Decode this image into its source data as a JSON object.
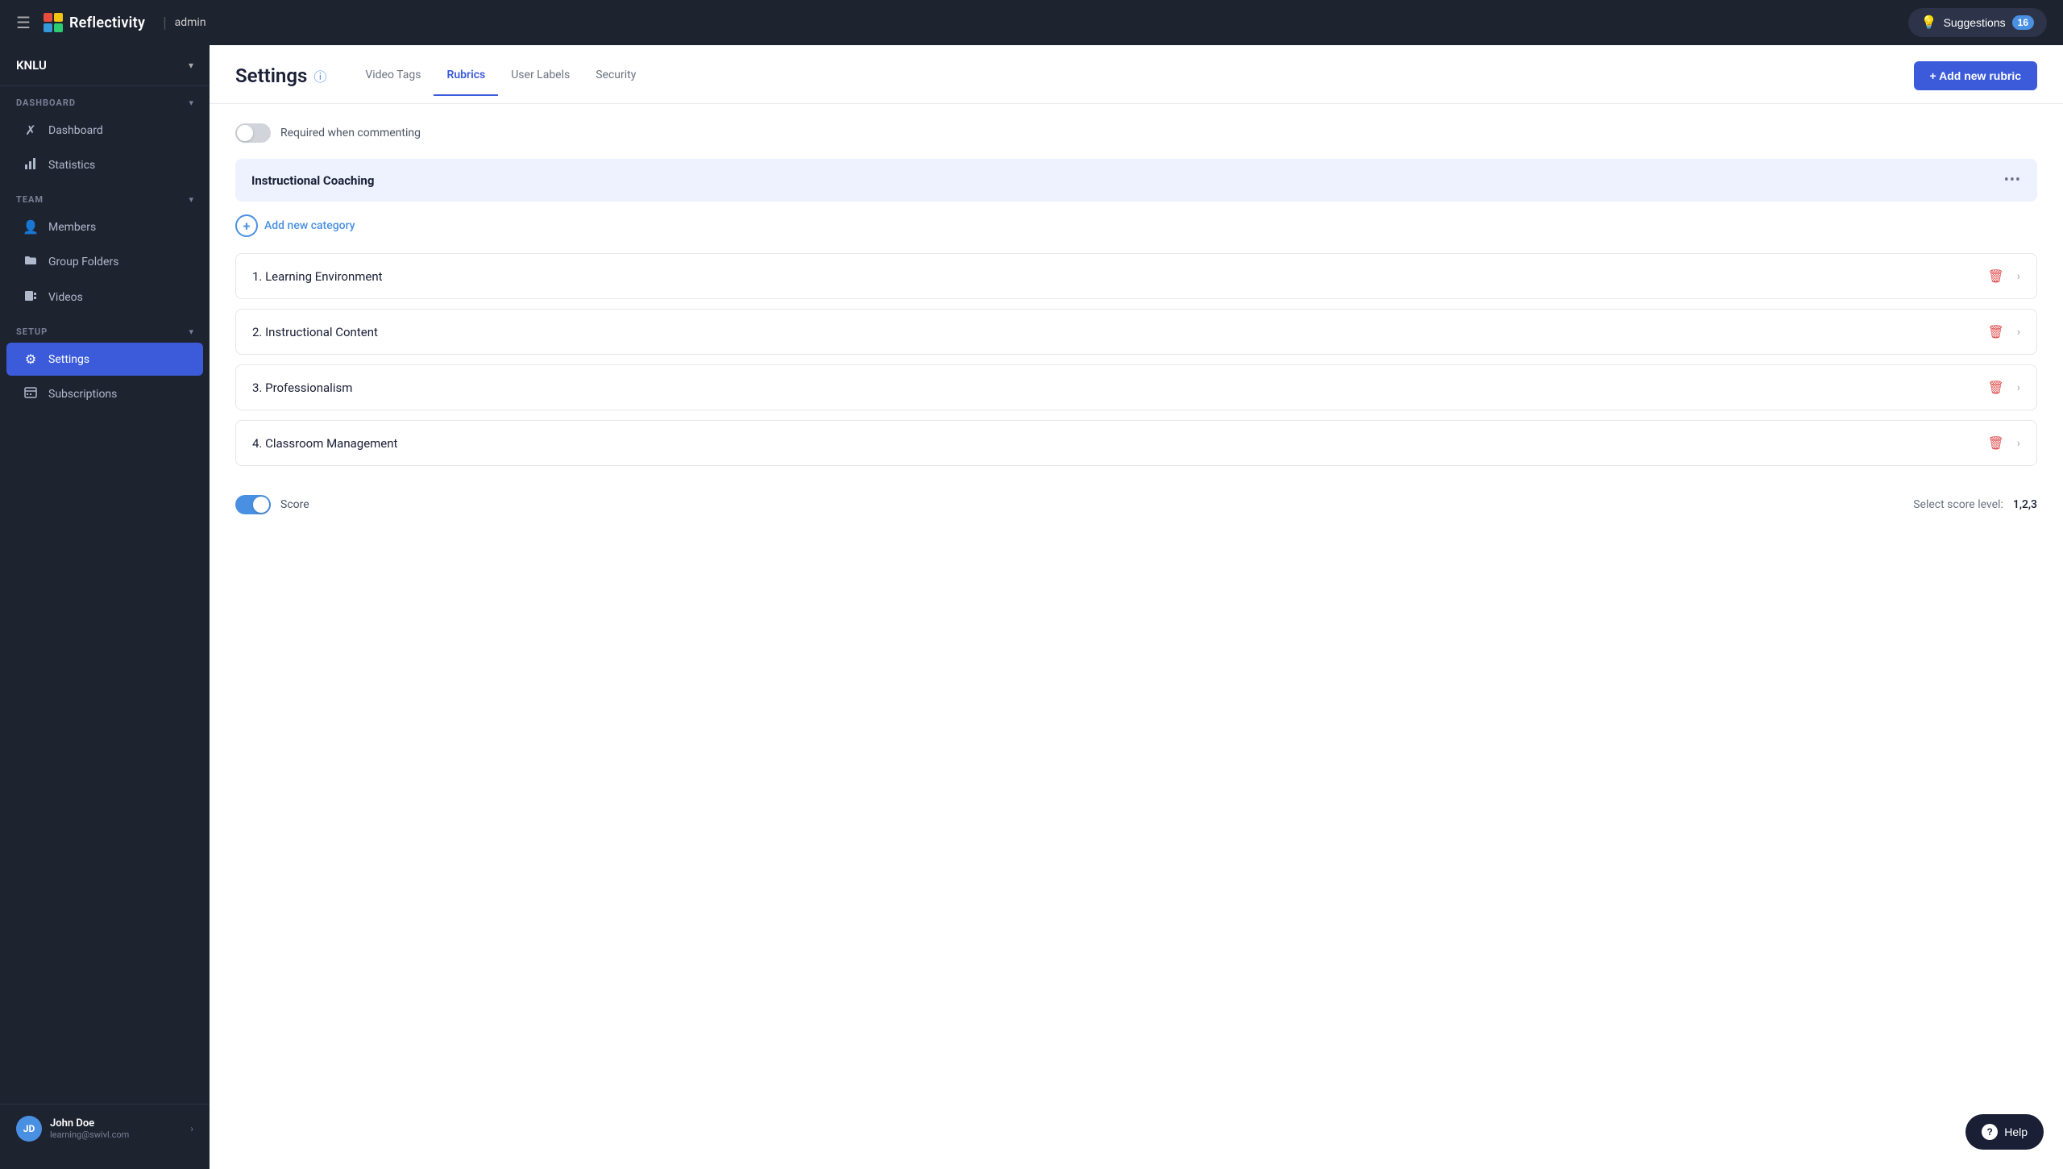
{
  "topbar": {
    "hamburger_label": "☰",
    "brand_name": "Reflectivity",
    "divider": "|",
    "admin_label": "admin",
    "suggestions_label": "Suggestions",
    "suggestions_count": "16"
  },
  "sidebar": {
    "org_name": "KNLU",
    "sections": [
      {
        "id": "dashboard",
        "label": "DASHBOARD",
        "items": [
          {
            "id": "dashboard",
            "label": "Dashboard",
            "icon": "✗",
            "active": false
          },
          {
            "id": "statistics",
            "label": "Statistics",
            "icon": "📊",
            "active": false
          }
        ]
      },
      {
        "id": "team",
        "label": "TEAM",
        "items": [
          {
            "id": "members",
            "label": "Members",
            "icon": "👤",
            "active": false
          },
          {
            "id": "group-folders",
            "label": "Group Folders",
            "icon": "📁",
            "active": false
          },
          {
            "id": "videos",
            "label": "Videos",
            "icon": "📋",
            "active": false
          }
        ]
      },
      {
        "id": "setup",
        "label": "SETUP",
        "items": [
          {
            "id": "settings",
            "label": "Settings",
            "icon": "⚙",
            "active": true
          },
          {
            "id": "subscriptions",
            "label": "Subscriptions",
            "icon": "📋",
            "active": false
          }
        ]
      }
    ],
    "user": {
      "initials": "JD",
      "name": "John Doe",
      "email": "learning@swivl.com"
    }
  },
  "settings": {
    "title": "Settings",
    "tabs": [
      {
        "id": "video-tags",
        "label": "Video Tags",
        "active": false
      },
      {
        "id": "rubrics",
        "label": "Rubrics",
        "active": true
      },
      {
        "id": "user-labels",
        "label": "User Labels",
        "active": false
      },
      {
        "id": "security",
        "label": "Security",
        "active": false
      }
    ],
    "add_rubric_label": "+ Add new rubric",
    "toggle_label": "Required when commenting",
    "category": {
      "name": "Instructional Coaching",
      "menu_icon": "•••"
    },
    "add_category_label": "Add new category",
    "rubric_items": [
      {
        "id": 1,
        "name": "1. Learning Environment"
      },
      {
        "id": 2,
        "name": "2. Instructional Content"
      },
      {
        "id": 3,
        "name": "3. Professionalism"
      },
      {
        "id": 4,
        "name": "4. Classroom Management"
      }
    ],
    "score_label": "Score",
    "score_level_label": "Select score level:",
    "score_level_value": "1,2,3"
  },
  "help": {
    "label": "Help",
    "icon": "?"
  }
}
